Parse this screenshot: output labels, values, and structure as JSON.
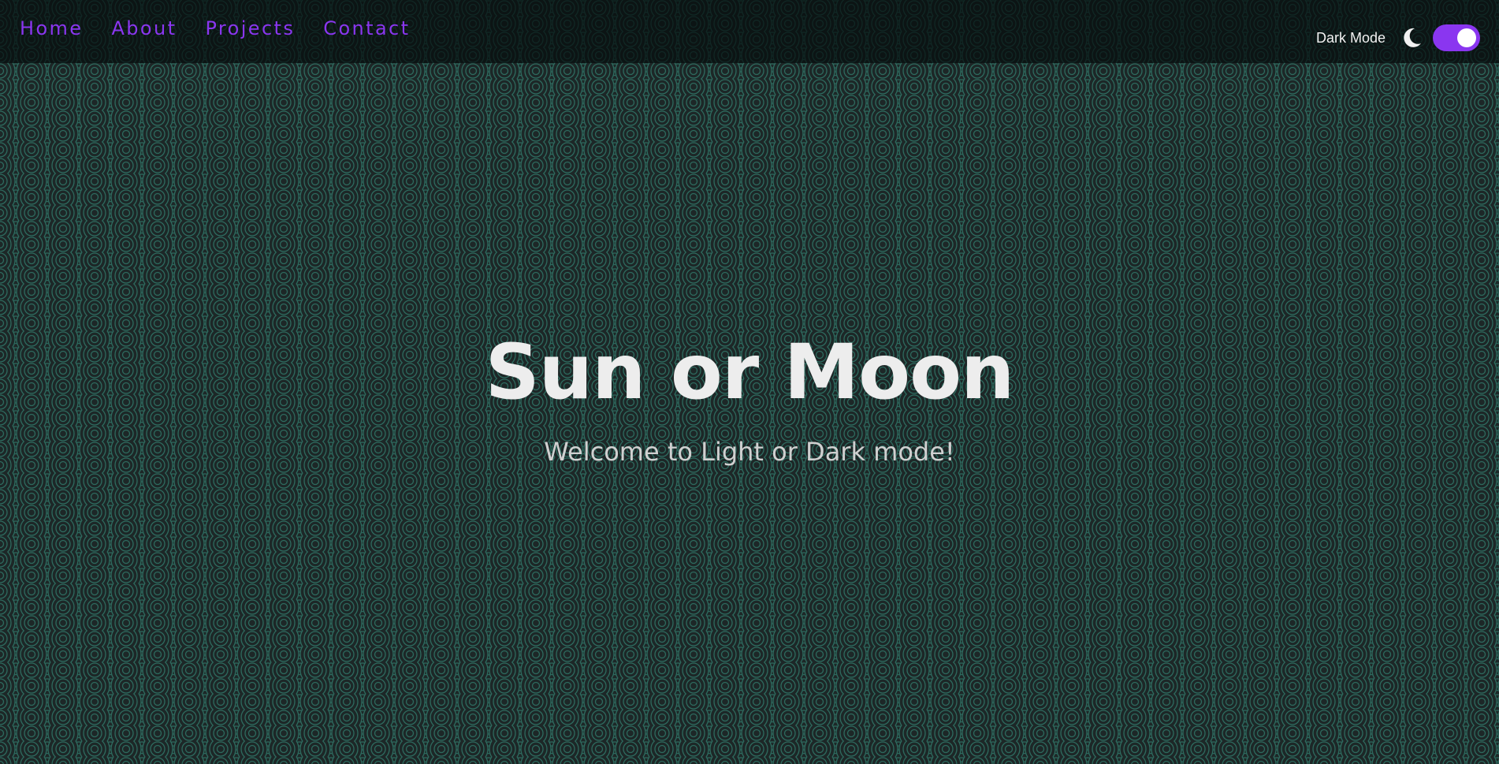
{
  "nav": {
    "links": [
      {
        "label": "Home"
      },
      {
        "label": "About"
      },
      {
        "label": "Projects"
      },
      {
        "label": "Contact"
      }
    ]
  },
  "theme": {
    "label": "Dark Mode",
    "icon": "moon-icon",
    "enabled": true
  },
  "hero": {
    "title": "Sun or Moon",
    "subtitle": "Welcome to Light or Dark mode!"
  },
  "colors": {
    "accent": "#8a36f0",
    "background": "#1f2a2a",
    "pattern_line": "#2d6a5e"
  }
}
